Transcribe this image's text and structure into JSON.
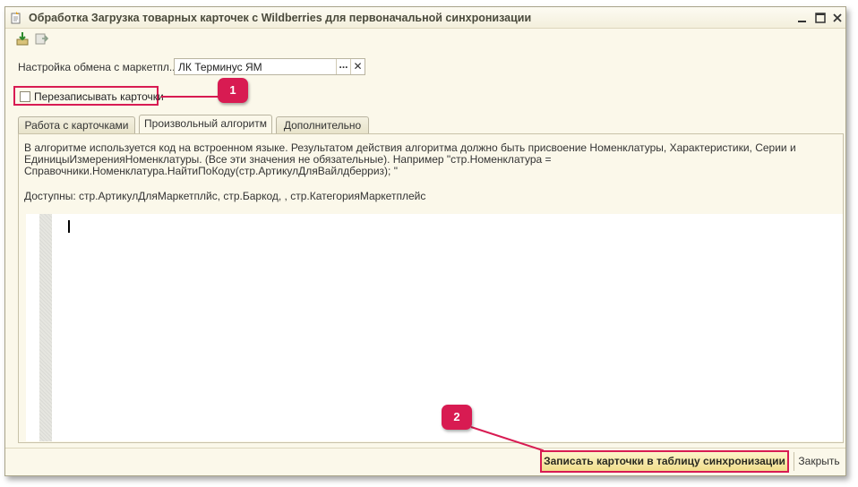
{
  "window": {
    "title": "Обработка  Загрузка товарных карточек с Wildberries для первоначальной синхронизации",
    "controls": [
      "minimize-icon",
      "maximize-icon",
      "close-icon"
    ]
  },
  "toolbar": {
    "buttons": [
      "load-icon",
      "export-icon"
    ]
  },
  "exchange": {
    "label": "Настройка обмена с маркетпл...",
    "value": "ЛК Терминус ЯМ",
    "select_label": "...",
    "clear_label": "✕"
  },
  "overwrite": {
    "label": "Перезаписывать карточки",
    "checked": false
  },
  "callouts": {
    "one": "1",
    "two": "2"
  },
  "tabs": [
    {
      "label": "Работа с карточками",
      "active": false
    },
    {
      "label": "Произвольный алгоритм",
      "active": true
    },
    {
      "label": "Дополнительно",
      "active": false
    }
  ],
  "panel": {
    "description_lines": [
      "В алгоритме используется код на встроенном языке. Результатом действия алгоритма должно быть присвоение Номенклатуры, Характеристики, Серии и",
      "ЕдиницыИзмеренияНоменклатуры. (Все эти значения не обязательные). Например \"стр.Номенклатура =",
      "Справочники.Номенклатура.НайтиПоКоду(стр.АртикулДляВайлдберриз); \""
    ],
    "available": "Доступны: стр.АртикулДляМаркетплйс, стр.Баркод, , стр.КатегорияМаркетплейс",
    "code": ""
  },
  "footer": {
    "write_label": "Записать карточки в таблицу синхронизации",
    "close_label": "Закрыть"
  },
  "colors": {
    "accent": "#d81b52",
    "window_bg": "#fbf8ea",
    "primary_button": "#f1dd8a"
  }
}
